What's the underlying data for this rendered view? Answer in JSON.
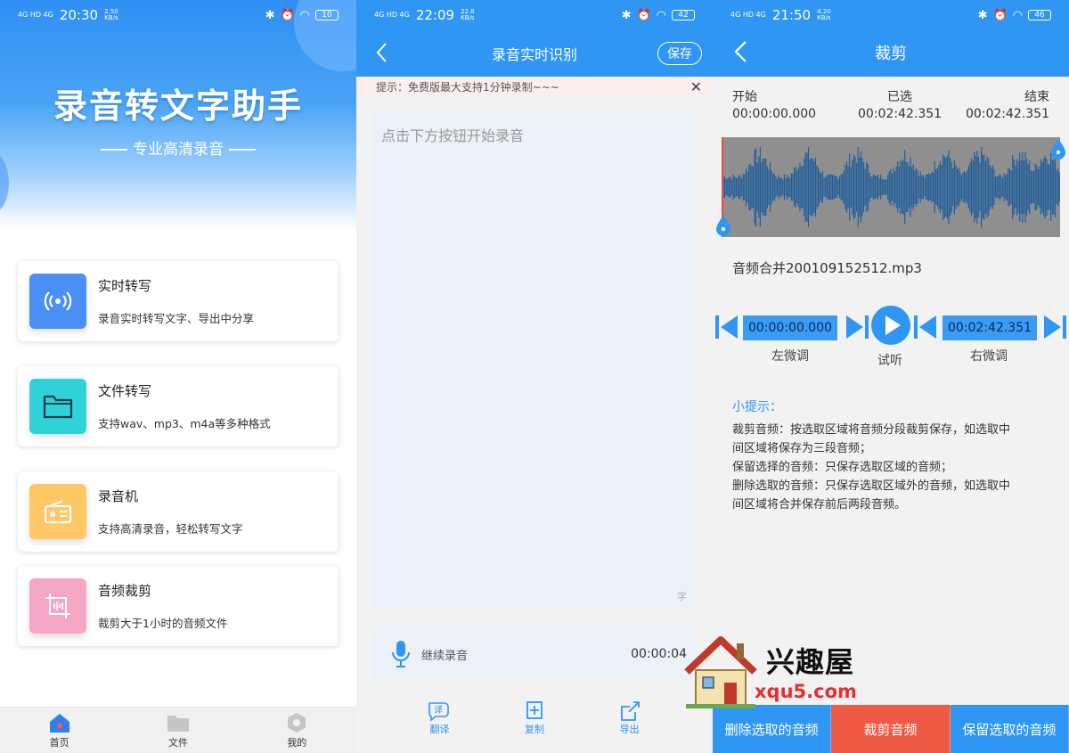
{
  "panels": [
    {
      "status": {
        "signal": "4G HD 4G",
        "time": "20:30",
        "speed": "2.50",
        "speed_unit": "KB/s",
        "battery": "10"
      },
      "app_title": "录音转文字助手",
      "subtitle": "专业高清录音",
      "features": [
        {
          "title": "实时转写",
          "desc": "录音实时转写文字、导出中分享",
          "icon": "broadcast-icon",
          "color": "#4a8ff5"
        },
        {
          "title": "文件转写",
          "desc": "支持wav、mp3、m4a等多种格式",
          "icon": "folder-icon",
          "color": "#2ed2d8"
        },
        {
          "title": "录音机",
          "desc": "支持高清录音，轻松转写文字",
          "icon": "radio-icon",
          "color": "#ffc766"
        },
        {
          "title": "音频裁剪",
          "desc": "裁剪大于1小时的音频文件",
          "icon": "crop-icon",
          "color": "#f5a6c6"
        }
      ],
      "nav": [
        {
          "label": "首页",
          "icon": "home-icon"
        },
        {
          "label": "文件",
          "icon": "folder-tab-icon"
        },
        {
          "label": "我的",
          "icon": "profile-icon"
        }
      ]
    },
    {
      "status": {
        "signal": "4G HD 4G",
        "time": "22:09",
        "speed": "22.8",
        "speed_unit": "KB/s",
        "battery": "42"
      },
      "title": "录音实时识别",
      "save_label": "保存",
      "tip": "提示：免费版最大支持1分钟录制~~~",
      "tip_close": "✕",
      "placeholder": "点击下方按钮开始录音",
      "char_unit": "字",
      "record_label": "继续录音",
      "record_time": "00:00:04",
      "actions": [
        {
          "label": "翻译",
          "icon": "translate-icon",
          "glyph": "译"
        },
        {
          "label": "复制",
          "icon": "copy-icon"
        },
        {
          "label": "导出",
          "icon": "export-icon"
        }
      ]
    },
    {
      "status": {
        "signal": "4G HD 4G",
        "time": "21:50",
        "speed": "4.20",
        "speed_unit": "KB/s",
        "battery": "46"
      },
      "title": "裁剪",
      "start_label": "开始",
      "start_time": "00:00:00.000",
      "selected_label": "已选",
      "selected_time": "00:02:42.351",
      "end_label": "结束",
      "end_time": "00:02:42.351",
      "filename": "音频合并200109152512.mp3",
      "left_time": "00:00:00.000",
      "right_time": "00:02:42.351",
      "left_fine": "左微调",
      "preview": "试听",
      "right_fine": "右微调",
      "tips_title": "小提示：",
      "tips": [
        "裁剪音频：按选取区域将音频分段裁剪保存，如选取中",
        "间区域将保存为三段音频；",
        "保留选择的音频：只保存选取区域的音频；",
        "删除选取的音频：只保存选取区域外的音频，如选取中",
        "间区域将合并保存前后两段音频。"
      ],
      "buttons": [
        {
          "label": "删除选取的音频",
          "color": "#2f96f3"
        },
        {
          "label": "裁剪音频",
          "color": "#ef5a45"
        },
        {
          "label": "保留选取的音频",
          "color": "#2f96f3"
        }
      ]
    }
  ],
  "watermark": {
    "title": "兴趣屋",
    "url": "xqu5.com"
  }
}
